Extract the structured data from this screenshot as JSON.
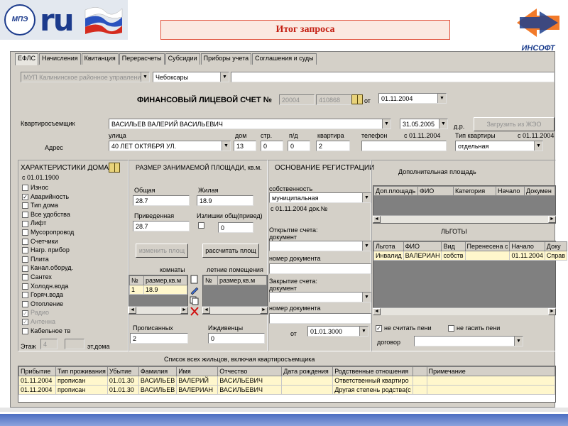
{
  "header": {
    "title": "Итог запроса",
    "logo_left_text": "МПЭ",
    "logo_ru": "ru",
    "logo_right_text": "ИНСОФТ"
  },
  "tabs": [
    "ЕФЛС",
    "Начисления",
    "Квитанция",
    "Перерасчеты",
    "Субсидии",
    "Приборы учета",
    "Соглашения и суды"
  ],
  "top": {
    "org": "МУП Калининское районное управлени",
    "city": "Чебоксары",
    "account_title": "ФИНАНСОВЫЙ ЛИЦЕВОЙ СЧЕТ №",
    "account_1": "20004",
    "account_2": "410868",
    "from_label": "от",
    "account_date": "01.11.2004",
    "tenant_label": "Квартиросъемщик",
    "tenant": "ВАСИЛЬЕВ ВАЛЕРИЙ ВАСИЛЬЕВИЧ",
    "tenant_date": "31.05.2005",
    "dr_label": "д.р.",
    "load_button": "Загрузить из ЖЭО",
    "street_label": "улица",
    "house_label": "дом",
    "building_label": "стр.",
    "entrance_label": "п/д",
    "apt_label": "квартира",
    "phone_label": "телефон",
    "phone_since": "с 01.11.2004",
    "apt_type_label": "Тип квартиры",
    "apt_type_since": "с 01.11.2004",
    "address_label": "Адрес",
    "street": "40 ЛЕТ ОКТЯБРЯ УЛ.",
    "house": "13",
    "building": "0",
    "entrance": "0",
    "apt": "2",
    "phone": "",
    "apt_type": "отдельная"
  },
  "house_chars": {
    "title": "ХАРАКТЕРИСТИКИ ДОМА",
    "since": "с 01.01.1900",
    "items": [
      {
        "label": "Износ",
        "checked": false,
        "disabled": false
      },
      {
        "label": "Аварийность",
        "checked": true,
        "disabled": false
      },
      {
        "label": "Тип дома",
        "checked": false,
        "disabled": false
      },
      {
        "label": "Все удобства",
        "checked": false,
        "disabled": false
      },
      {
        "label": "Лифт",
        "checked": false,
        "disabled": false
      },
      {
        "label": "Мусоропровод",
        "checked": false,
        "disabled": false
      },
      {
        "label": "Счетчики",
        "checked": false,
        "disabled": false
      },
      {
        "label": "Нагр. прибор",
        "checked": false,
        "disabled": false
      },
      {
        "label": "Плита",
        "checked": false,
        "disabled": false
      },
      {
        "label": "Канал.оборуд.",
        "checked": false,
        "disabled": false
      },
      {
        "label": "Сантех",
        "checked": false,
        "disabled": false
      },
      {
        "label": "Холодн.вода",
        "checked": false,
        "disabled": false
      },
      {
        "label": "Горяч.вода",
        "checked": false,
        "disabled": false
      },
      {
        "label": "Отопление",
        "checked": false,
        "disabled": false
      },
      {
        "label": "Радио",
        "checked": true,
        "disabled": true
      },
      {
        "label": "Антенна",
        "checked": true,
        "disabled": true
      },
      {
        "label": "Кабельное тв",
        "checked": false,
        "disabled": false
      }
    ],
    "floor_label": "Этаж",
    "floor": "4",
    "floors_label": "эт.дома",
    "floors": ""
  },
  "area": {
    "title": "РАЗМЕР ЗАНИМАЕМОЙ ПЛОЩАДИ, кв.м.",
    "total_label": "Общая",
    "total": "28.7",
    "living_label": "Жилая",
    "living": "18.9",
    "reduced_label": "Приведенная",
    "reduced": "28.7",
    "excess_label": "Излишки общ(привед)",
    "excess": "0",
    "change_button": "изменить площ",
    "calc_button": "рассчитать площ",
    "rooms_label": "комнаты",
    "summer_label": "летние помещения",
    "rooms_cols": [
      "№",
      "размер,кв.м"
    ],
    "rooms_rows": [
      [
        "1",
        "18.9"
      ]
    ],
    "summer_cols": [
      "№",
      "размер,кв.м"
    ],
    "registered_label": "Прописанных",
    "registered": "2",
    "dependents_label": "Иждивенцы",
    "dependents": "0"
  },
  "reg": {
    "title": "ОСНОВАНИЕ РЕГИСТРАЦИИ",
    "ownership_label": "собственность",
    "ownership": "муниципальная",
    "ownership_since": "с 01.11.2004 док.№",
    "open_label": "Открытие счета: документ",
    "doc_number_label": "номер документа",
    "close_label": "Закрытие счета: документ",
    "doc_number_label_2": "номер документа",
    "from_label": "от",
    "close_date": "01.01.3000"
  },
  "extra_area": {
    "title": "Дополнительная площадь",
    "cols": [
      "Доп.площадь",
      "ФИО",
      "Категория",
      "Начало",
      "Докумен"
    ]
  },
  "benefits": {
    "title": "ЛЬГОТЫ",
    "cols": [
      "Льгота",
      "ФИО",
      "Вид",
      "Перенесена с",
      "Начало",
      "Доку"
    ],
    "rows": [
      [
        "Инвалид",
        "ВАЛЕРИАН",
        "собств",
        "",
        "01.11.2004",
        "Справ"
      ]
    ],
    "no_penalty_label": "не считать пени",
    "no_penalty": true,
    "no_pay_penalty_label": "не гасить пени",
    "no_pay_penalty": false,
    "contract_label": "договор"
  },
  "residents": {
    "title": "Список всех жильцов, включая квартиросъемщика",
    "cols": [
      "Прибытие",
      "Тип проживания",
      "Убытие",
      "Фамилия",
      "Имя",
      "Отчество",
      "Дата рождения",
      "Родственные отношения",
      "",
      "Примечание"
    ],
    "rows": [
      [
        "01.11.2004",
        "прописан",
        "01.01.30",
        "ВАСИЛЬЕВ",
        "ВАЛЕРИЙ",
        "ВАСИЛЬЕВИЧ",
        "",
        "Ответственный квартиро",
        "",
        ""
      ],
      [
        "01.11.2004",
        "прописан",
        "01.01.30",
        "ВАСИЛЬЕВ",
        "ВАЛЕРИАН",
        "ВАСИЛЬЕВИЧ",
        "",
        "Другая степень родства(с",
        "",
        ""
      ]
    ]
  }
}
